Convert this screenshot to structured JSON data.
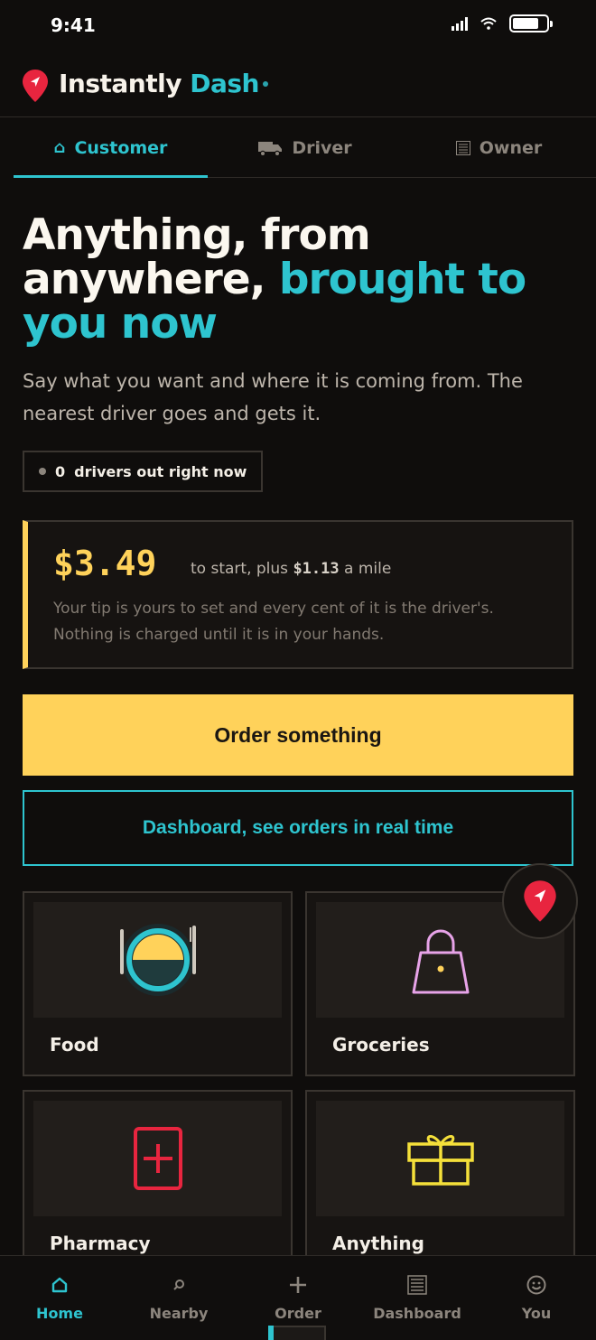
{
  "status": {
    "time": "9:41"
  },
  "brand": {
    "name_part1": "Instantly",
    "name_part2": "Dash"
  },
  "role_tabs": [
    {
      "label": "Customer",
      "icon": "home-icon",
      "active": true
    },
    {
      "label": "Driver",
      "icon": "truck-icon",
      "active": false
    },
    {
      "label": "Owner",
      "icon": "ledger-icon",
      "active": false
    }
  ],
  "hero": {
    "title_part1": "Anything, from anywhere,",
    "title_highlight": "brought to you now",
    "subtitle": "Say what you want and where it is coming from. The nearest driver goes and gets it."
  },
  "drivers_status": {
    "count": "0",
    "label": "drivers out right now"
  },
  "pricing": {
    "base": "$3.49",
    "to_start": "to start, plus",
    "per_mile": "$1.13",
    "mile_suffix": "a mile",
    "note": "Your tip is yours to set and every cent of it is the driver's. Nothing is charged until it is in your hands."
  },
  "actions": {
    "order_label": "Order something",
    "dashboard_label": "Dashboard, see orders in real time"
  },
  "categories": [
    {
      "label": "Food",
      "icon": "plate-icon"
    },
    {
      "label": "Groceries",
      "icon": "shopping-bag-icon"
    },
    {
      "label": "Pharmacy",
      "icon": "medical-cross-icon"
    },
    {
      "label": "Anything",
      "icon": "gift-icon"
    }
  ],
  "bottom_nav": [
    {
      "label": "Home",
      "icon": "home-icon",
      "active": true
    },
    {
      "label": "Nearby",
      "icon": "search-icon",
      "active": false
    },
    {
      "label": "Order",
      "icon": "plus-icon",
      "active": false
    },
    {
      "label": "Dashboard",
      "icon": "ledger-icon",
      "active": false
    },
    {
      "label": "You",
      "icon": "smiley-icon",
      "active": false
    }
  ],
  "colors": {
    "accent": "#2ec4cf",
    "primary": "#ffd25a",
    "brand_red": "#e8253f",
    "background": "#0f0d0c"
  }
}
